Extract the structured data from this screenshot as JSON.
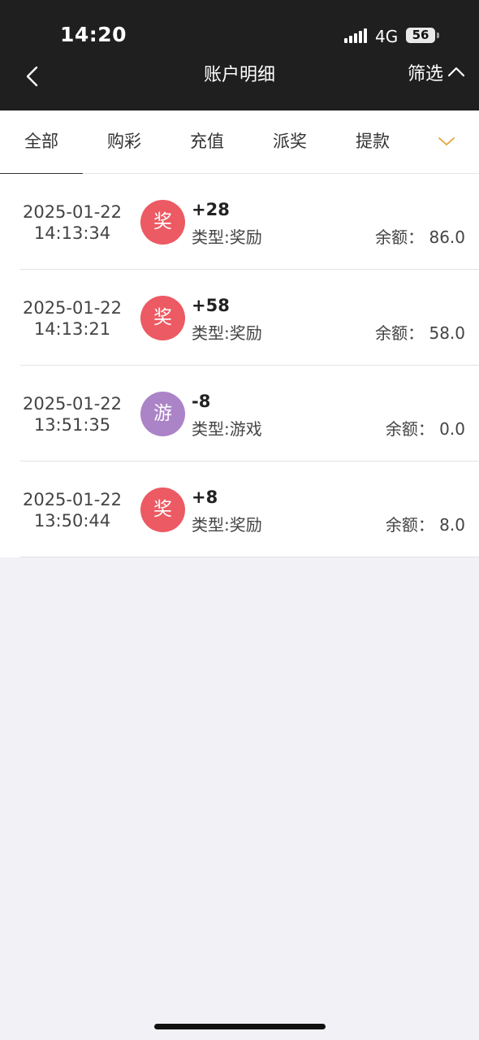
{
  "status_bar": {
    "time": "14:20",
    "network": "4G",
    "battery": "56",
    "signal_icon": "signal-bars-icon"
  },
  "nav": {
    "title": "账户明细",
    "filter_label": "筛选",
    "back_icon": "chevron-left-icon",
    "filter_icon": "chevron-up-icon"
  },
  "tabs": [
    {
      "label": "全部",
      "active": true
    },
    {
      "label": "购彩",
      "active": false
    },
    {
      "label": "充值",
      "active": false
    },
    {
      "label": "派奖",
      "active": false
    },
    {
      "label": "提款",
      "active": false
    }
  ],
  "tabs_more_icon": "chevron-down-icon",
  "colors": {
    "header_bg": "#1f1f1f",
    "reward_badge": "#ec5a63",
    "game_badge": "#ab83c7",
    "more_arrow": "#e5a23a",
    "page_bg": "#f1f1f6"
  },
  "transactions": [
    {
      "date": "2025-01-22",
      "time": "14:13:34",
      "badge": "奖",
      "badge_color": "#ec5a63",
      "amount": "+28",
      "type": "类型:奖励",
      "balance": "余额： 86.0"
    },
    {
      "date": "2025-01-22",
      "time": "14:13:21",
      "badge": "奖",
      "badge_color": "#ec5a63",
      "amount": "+58",
      "type": "类型:奖励",
      "balance": "余额： 58.0"
    },
    {
      "date": "2025-01-22",
      "time": "13:51:35",
      "badge": "游",
      "badge_color": "#ab83c7",
      "amount": "-8",
      "type": "类型:游戏",
      "balance": "余额： 0.0"
    },
    {
      "date": "2025-01-22",
      "time": "13:50:44",
      "badge": "奖",
      "badge_color": "#ec5a63",
      "amount": "+8",
      "type": "类型:奖励",
      "balance": "余额： 8.0"
    }
  ]
}
